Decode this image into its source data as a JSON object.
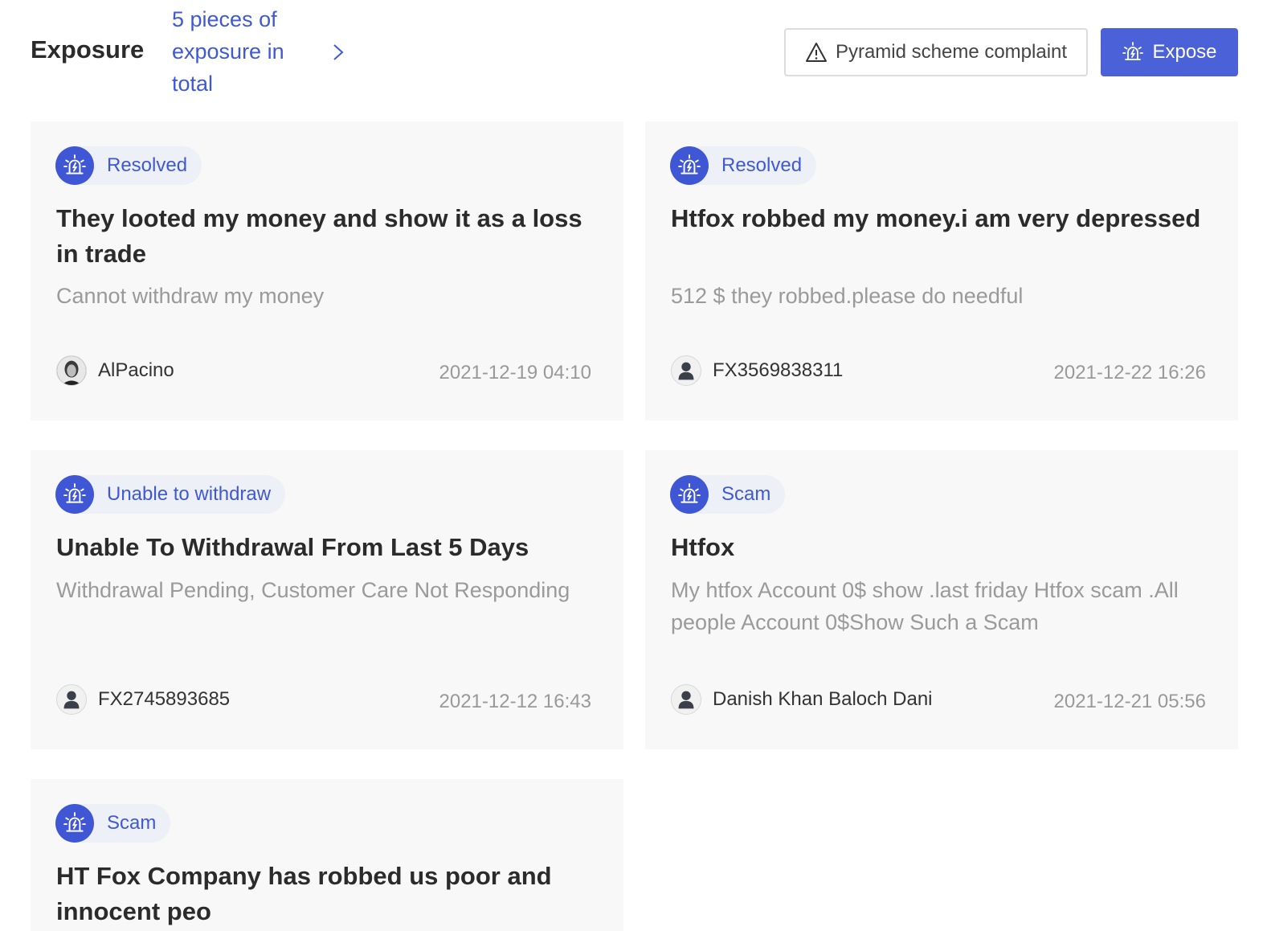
{
  "header": {
    "title": "Exposure",
    "total_text": "5 pieces of exposure in total",
    "complaint_label": "Pyramid scheme complaint",
    "expose_label": "Expose"
  },
  "colors": {
    "accent": "#4a61d8",
    "card_bg": "#f8f8f9",
    "tag_bg": "#eef0f7",
    "muted_text": "#9a9a9a"
  },
  "cards": [
    {
      "tag": "Resolved",
      "title": "They looted my money and show it as a loss in trade",
      "description": "Cannot withdraw my money",
      "author": "AlPacino",
      "date": "2021-12-19 04:10",
      "avatar": "photo-avatar-icon"
    },
    {
      "tag": "Resolved",
      "title": "Htfox robbed my money.i am very depressed",
      "description": "512 $ they robbed.please do needful",
      "author": "FX3569838311",
      "date": "2021-12-22 16:26",
      "avatar": "default-user-icon"
    },
    {
      "tag": "Unable to withdraw",
      "title": "Unable To Withdrawal From Last 5 Days",
      "description": "Withdrawal Pending, Customer Care Not Responding",
      "author": "FX2745893685",
      "date": "2021-12-12 16:43",
      "avatar": "default-user-icon"
    },
    {
      "tag": "Scam",
      "title": "Htfox",
      "description": "My htfox Account 0$ show .last friday Htfox scam .All people Account 0$Show Such a Scam",
      "author": "Danish Khan Baloch Dani",
      "date": "2021-12-21 05:56",
      "avatar": "default-user-icon"
    },
    {
      "tag": "Scam",
      "title": "HT Fox Company has robbed us poor and innocent peo",
      "description": "",
      "author": "",
      "date": "",
      "avatar": ""
    }
  ]
}
